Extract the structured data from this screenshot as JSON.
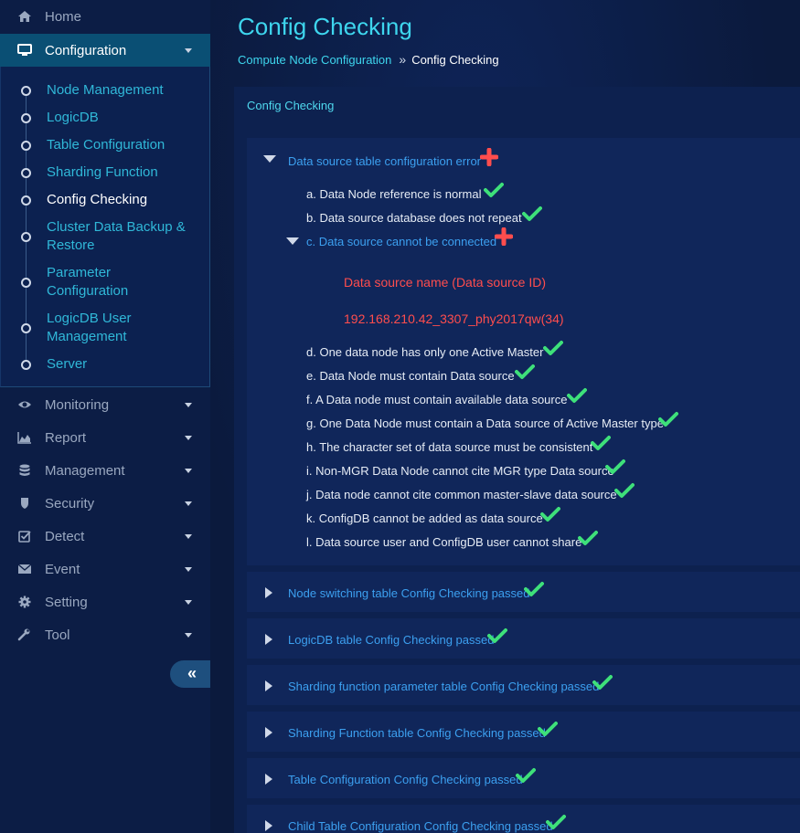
{
  "sidebar": {
    "home": "Home",
    "configuration": "Configuration",
    "sub_items": [
      "Node Management",
      "LogicDB",
      "Table Configuration",
      "Sharding Function",
      "Config Checking",
      "Cluster Data Backup & Restore",
      "Parameter Configuration",
      "LogicDB User Management",
      "Server"
    ],
    "monitoring": "Monitoring",
    "report": "Report",
    "management": "Management",
    "security": "Security",
    "detect": "Detect",
    "event": "Event",
    "setting": "Setting",
    "tool": "Tool",
    "collapse_glyph": "«"
  },
  "page": {
    "title": "Config Checking",
    "breadcrumb_parent": "Compute Node Configuration",
    "breadcrumb_sep": "»",
    "breadcrumb_current": "Config Checking",
    "panel_title": "Config Checking"
  },
  "sections": [
    {
      "label": "Data source table configuration error",
      "status": "error",
      "expanded": true
    },
    {
      "label": "Node switching table Config Checking passed",
      "status": "pass"
    },
    {
      "label": "LogicDB table Config Checking passed",
      "status": "pass"
    },
    {
      "label": "Sharding function parameter table Config Checking passed",
      "status": "pass"
    },
    {
      "label": "Sharding Function table Config Checking passed",
      "status": "pass"
    },
    {
      "label": "Table Configuration Config Checking passed",
      "status": "pass"
    },
    {
      "label": "Child Table Configuration Config Checking passed",
      "status": "pass"
    }
  ],
  "checks": [
    {
      "label": "a. Data Node reference is normal",
      "status": "pass"
    },
    {
      "label": "b. Data source database does not repeat",
      "status": "pass"
    },
    {
      "label": "c. Data source cannot be connected",
      "status": "error"
    },
    {
      "label": "d. One data node has only one Active Master",
      "status": "pass"
    },
    {
      "label": "e. Data Node must contain Data source",
      "status": "pass"
    },
    {
      "label": "f. A Data node must contain available data source",
      "status": "pass"
    },
    {
      "label": "g. One Data Node must contain a Data source of Active Master type",
      "status": "pass"
    },
    {
      "label": "h. The character set of data source must be consistent",
      "status": "pass"
    },
    {
      "label": "i. Non-MGR Data Node cannot cite MGR type Data source",
      "status": "pass"
    },
    {
      "label": "j. Data node cannot cite common master-slave data source",
      "status": "pass"
    },
    {
      "label": "k. ConfigDB cannot be added as data source",
      "status": "pass"
    },
    {
      "label": "l. Data source user and ConfigDB user cannot share",
      "status": "pass"
    }
  ],
  "error_detail": {
    "header": "Data source name (Data source ID)",
    "value": "192.168.210.42_3307_phy2017qw(34)"
  },
  "colors": {
    "accent": "#3ed6ee",
    "link": "#3ca0f0",
    "pass": "#3ee07a",
    "error": "#ff4d4d",
    "active_nav": "#0a4f74"
  },
  "icons": {
    "home": "home-icon",
    "configuration": "monitor-icon",
    "monitoring": "eye-icon",
    "report": "area-chart-icon",
    "management": "database-icon",
    "security": "shield-icon",
    "detect": "checkbox-icon",
    "event": "envelope-icon",
    "setting": "gear-icon",
    "tool": "wrench-icon",
    "pass": "check-icon",
    "error": "cross-icon"
  }
}
